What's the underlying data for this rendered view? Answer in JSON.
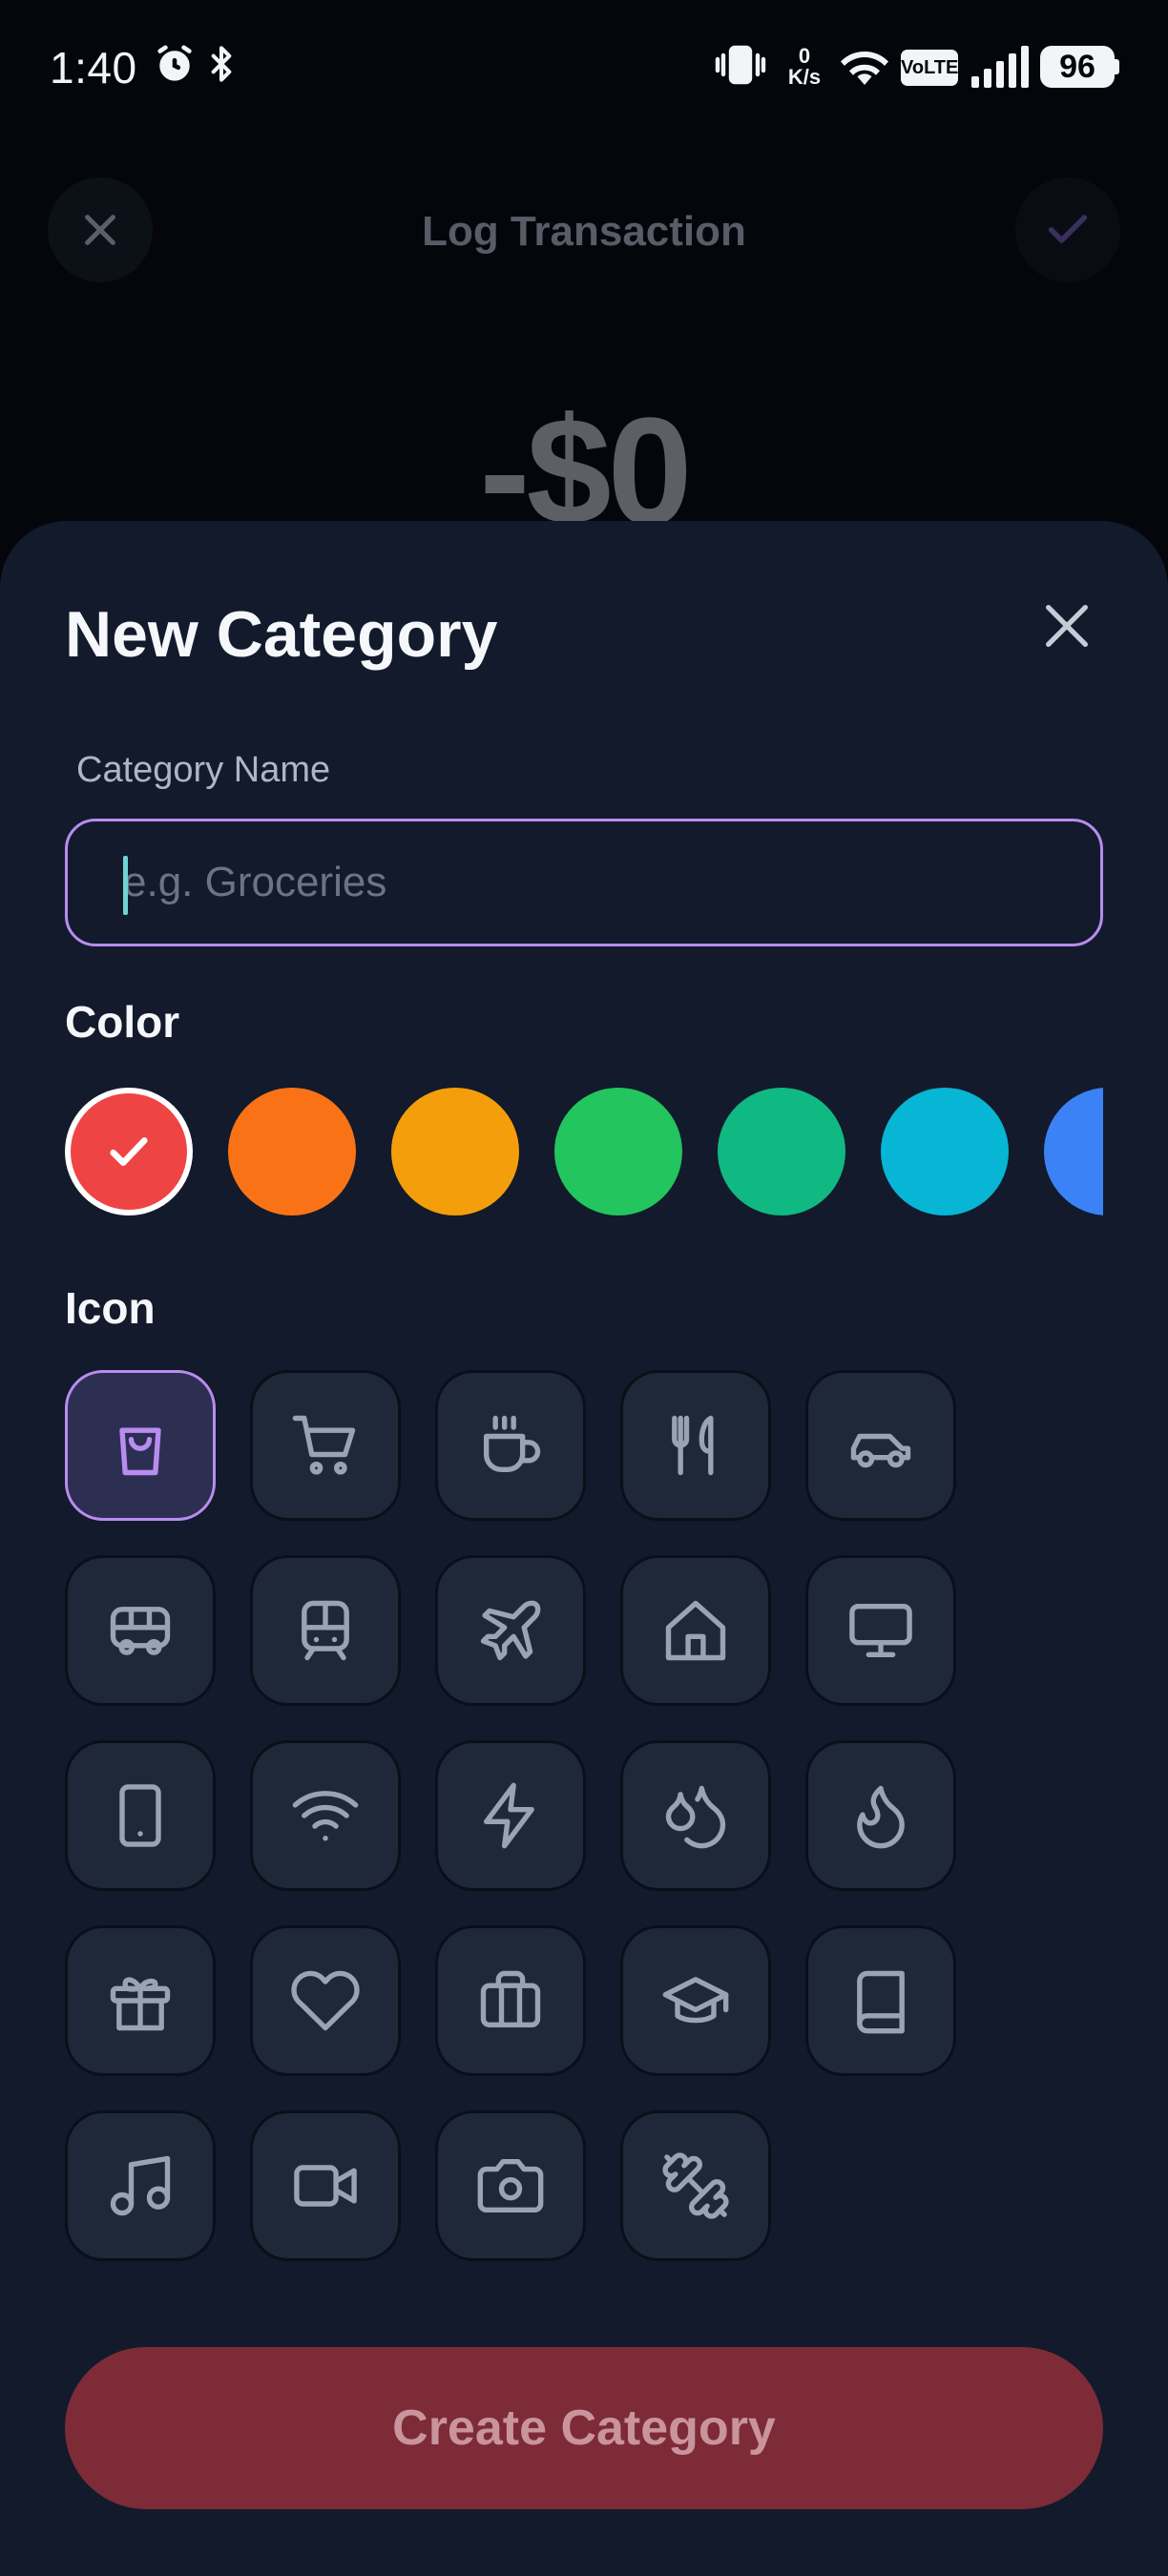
{
  "status_bar": {
    "time": "1:40",
    "net_speed_value": "0",
    "net_speed_unit": "K/s",
    "volte": "VoLTE",
    "battery": "96"
  },
  "background": {
    "title": "Log Transaction",
    "amount": "-$0"
  },
  "sheet": {
    "title": "New Category",
    "name_label": "Category Name",
    "name_placeholder": "e.g. Groceries",
    "name_value": "",
    "color_label": "Color",
    "icon_label": "Icon",
    "create_label": "Create Category"
  },
  "colors": [
    {
      "hex": "#ef4444",
      "selected": true
    },
    {
      "hex": "#f97316",
      "selected": false
    },
    {
      "hex": "#f59e0b",
      "selected": false
    },
    {
      "hex": "#22c55e",
      "selected": false
    },
    {
      "hex": "#10b981",
      "selected": false
    },
    {
      "hex": "#06b6d4",
      "selected": false
    },
    {
      "hex": "#3b82f6",
      "selected": false
    }
  ],
  "icons": [
    {
      "name": "shopping-bag-icon",
      "selected": true
    },
    {
      "name": "shopping-cart-icon",
      "selected": false
    },
    {
      "name": "coffee-icon",
      "selected": false
    },
    {
      "name": "utensils-icon",
      "selected": false
    },
    {
      "name": "car-icon",
      "selected": false
    },
    {
      "name": "bus-icon",
      "selected": false
    },
    {
      "name": "train-icon",
      "selected": false
    },
    {
      "name": "plane-icon",
      "selected": false
    },
    {
      "name": "home-icon",
      "selected": false
    },
    {
      "name": "monitor-icon",
      "selected": false
    },
    {
      "name": "smartphone-icon",
      "selected": false
    },
    {
      "name": "wifi-icon",
      "selected": false
    },
    {
      "name": "zap-icon",
      "selected": false
    },
    {
      "name": "droplets-icon",
      "selected": false
    },
    {
      "name": "flame-icon",
      "selected": false
    },
    {
      "name": "gift-icon",
      "selected": false
    },
    {
      "name": "heart-icon",
      "selected": false
    },
    {
      "name": "briefcase-icon",
      "selected": false
    },
    {
      "name": "graduation-cap-icon",
      "selected": false
    },
    {
      "name": "book-icon",
      "selected": false
    },
    {
      "name": "music-icon",
      "selected": false
    },
    {
      "name": "video-icon",
      "selected": false
    },
    {
      "name": "camera-icon",
      "selected": false
    },
    {
      "name": "dumbbell-icon",
      "selected": false
    }
  ],
  "accent": "#b98cf0",
  "icon_color": "#9aa3b2"
}
